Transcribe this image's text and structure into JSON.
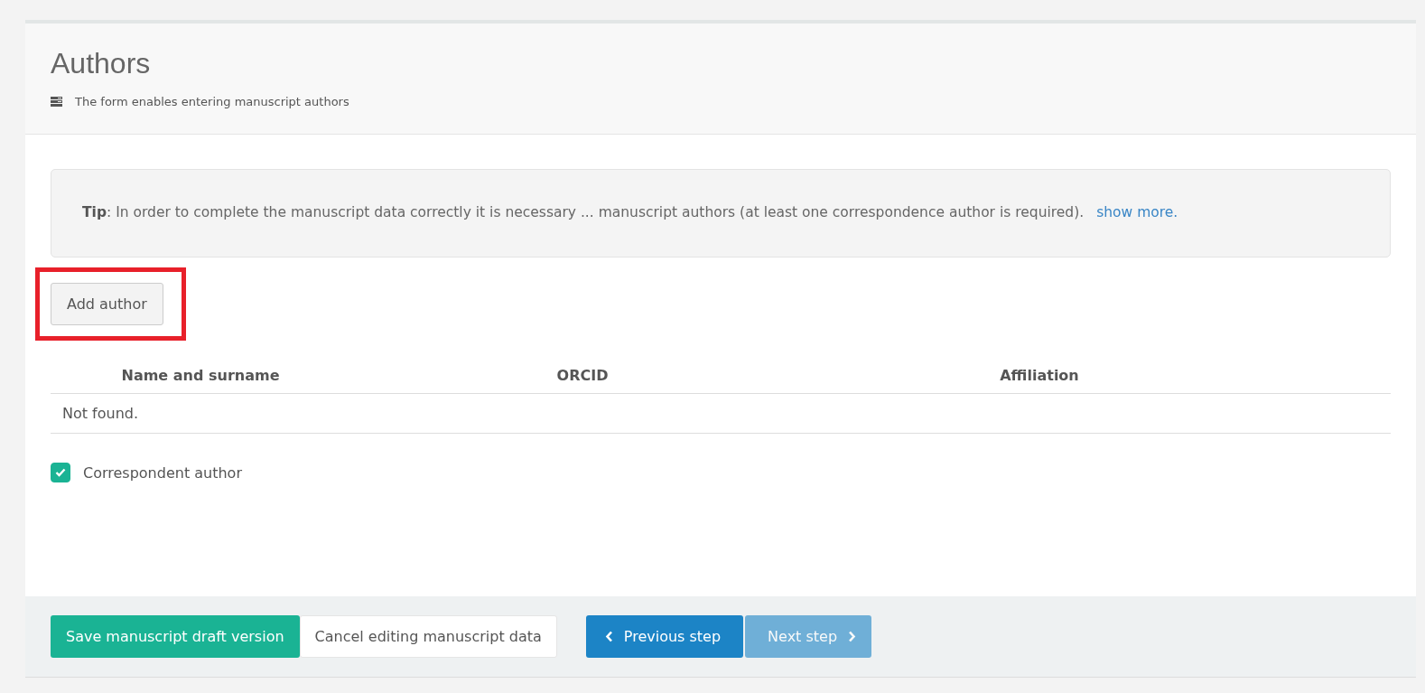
{
  "panel": {
    "title": "Authors",
    "subtitle": "The form enables entering manuscript authors"
  },
  "tip": {
    "text": "**Tip**: In order to complete the manuscript data correctly it is necessary ... manuscript authors (at least one correspondence author is required).",
    "link": "show more."
  },
  "add_button": {
    "label": "Add author",
    "highlighted": true
  },
  "table": {
    "columns": [
      "Name and surname",
      "ORCID",
      "Affiliation"
    ],
    "empty_text": "Not found."
  },
  "correspondent": {
    "label": "Correspondent author",
    "checked": true
  },
  "footer": {
    "buttons": [
      {
        "label": "Save manuscript draft version",
        "kind": "primary",
        "disabled": false
      },
      {
        "label": "Cancel editing manuscript data",
        "kind": "default",
        "disabled": false
      },
      {
        "label": "Previous step",
        "kind": "back",
        "disabled": false
      },
      {
        "label": "Next step",
        "kind": "forward",
        "disabled": true
      }
    ]
  }
}
